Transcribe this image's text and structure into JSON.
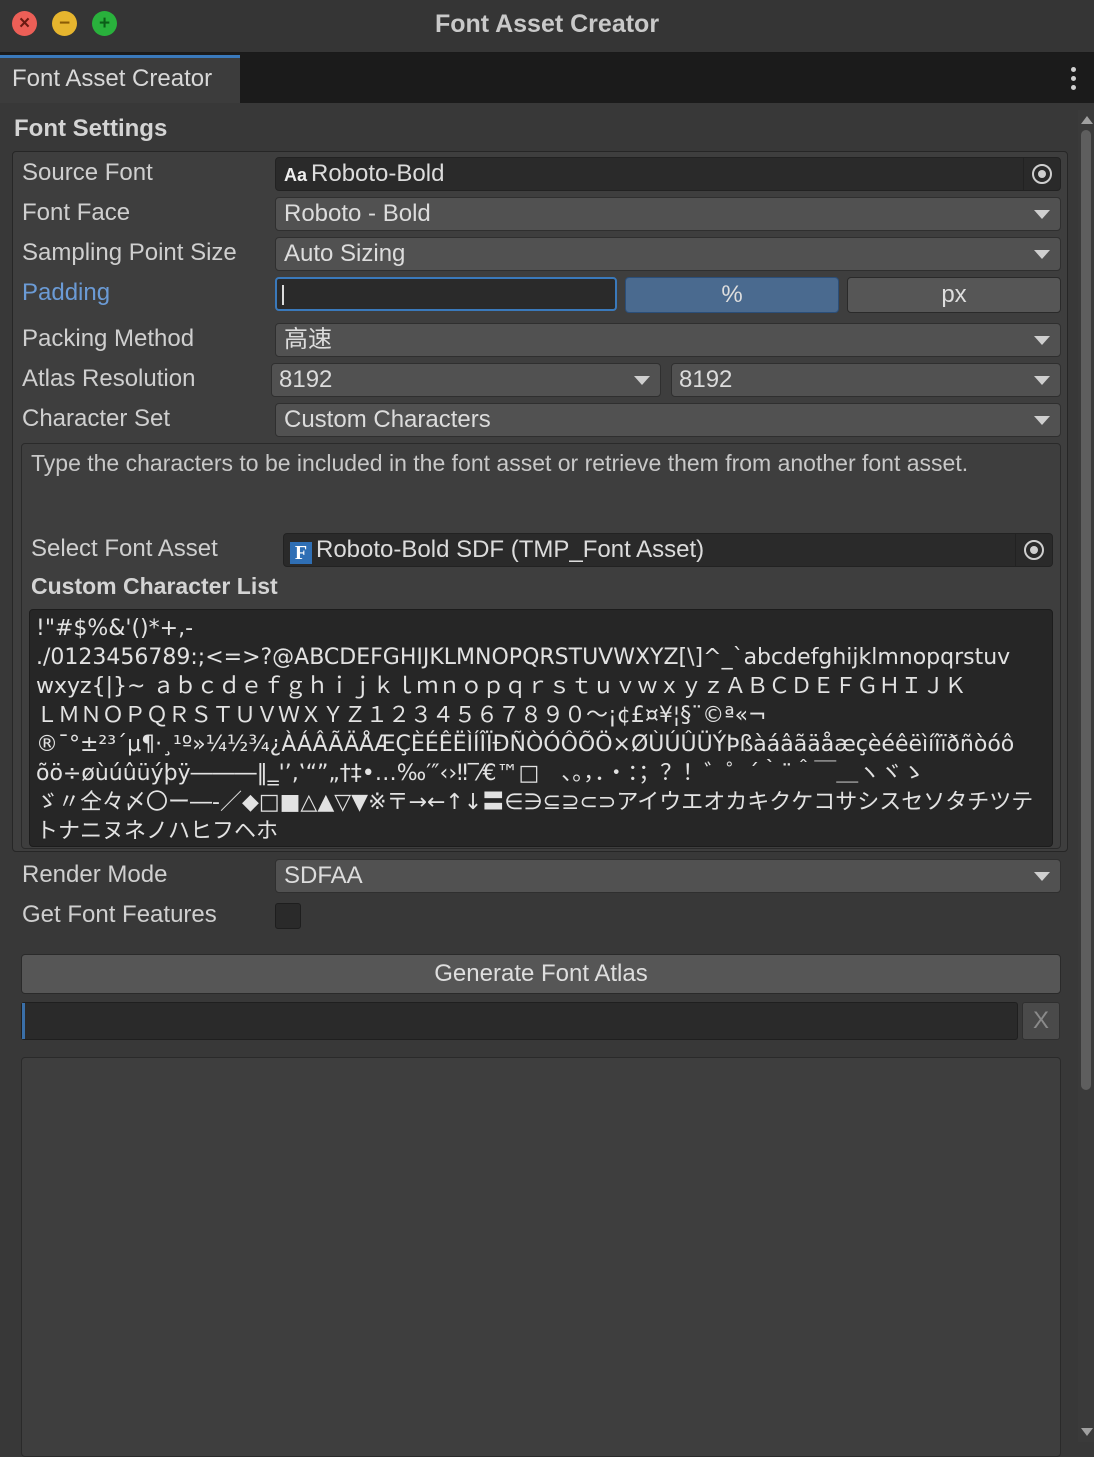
{
  "window": {
    "title": "Font Asset Creator",
    "tab_label": "Font Asset Creator"
  },
  "font_settings": {
    "section_title": "Font Settings",
    "source_font": {
      "label": "Source Font",
      "value": "Roboto-Bold",
      "icon": "font-aa-icon"
    },
    "font_face": {
      "label": "Font Face",
      "value": "Roboto - Bold"
    },
    "sampling_point_size": {
      "label": "Sampling Point Size",
      "value": "Auto Sizing"
    },
    "padding": {
      "label": "Padding",
      "value": "",
      "unit_percent": "%",
      "unit_px": "px",
      "selected_unit": "%"
    },
    "packing_method": {
      "label": "Packing Method",
      "value": "高速"
    },
    "atlas_resolution": {
      "label": "Atlas Resolution",
      "width": "8192",
      "height": "8192"
    },
    "character_set": {
      "label": "Character Set",
      "value": "Custom Characters"
    },
    "help_text": "Type the characters to be included in the font asset or retrieve them from another font asset.",
    "select_font_asset": {
      "label": "Select Font Asset",
      "value": "Roboto-Bold SDF (TMP_Font Asset)",
      "icon": "font-asset-f-icon"
    },
    "custom_character_list": {
      "label": "Custom Character List",
      "value": "!\"#$%&'()*+,-\n./0123456789:;<=>?@ABCDEFGHIJKLMNOPQRSTUVWXYZ[\\]^_`abcdefghijklmnopqrstuv\nwxyz{|}~ ａｂｃｄｅｆｇｈｉｊｋｌｍｎｏｐｑｒｓｔｕｖｗｘｙｚＡＢＣＤＥＦＧＨＩＪＫ\nＬＭＮＯＰＱＲＳＴＵＶＷＸＹＺ１２３４５６７８９０～¡¢£¤¥¦§¨©ª«¬\n®¯°±²³´µ¶·¸¹º»¼½¾¿ÀÁÂÃÄÅÆÇÈÉÊËÌÍÎÏÐÑÒÓÔÕÖ×ØÙÚÛÜÝÞßàáâãäåæçèéêëìíîïðñòóô\nõö÷øùúûüýþÿ―――‖‗'’‚‛“”„†‡•…‰′″‹›‼‾⁄€™□　、。，．・：；？！゛゜´｀¨＾￣＿ヽヾゝ\nゞ〃仝々〆〇ー―‐／◆□■△▲▽▼※〒→←↑↓〓∈∋⊆⊇⊂⊃アイウエオカキクケコサシスセソタチツテトナニヌネノハヒフヘホ\nマミムメモヤユヨラリルレロワヲンァィゥェォッャュョーガギグゲゴザジズゼゾダヂヅデドバビブベボパピプペポヴぁあぃ\nぃぅうぇえぉおかがきぎくぐけげこごさざしじすずせぜそぞただちぢっつづてでとどなにぬねのはばぱひびぴふぶぷへべぺほぼぽ"
    },
    "render_mode": {
      "label": "Render Mode",
      "value": "SDFAA"
    },
    "get_font_features": {
      "label": "Get Font Features",
      "checked": false
    }
  },
  "actions": {
    "generate_label": "Generate Font Atlas",
    "cancel_label": "X",
    "progress": 0.002
  },
  "colors": {
    "accent": "#3a79bb",
    "label_highlight": "#6b9bd6"
  }
}
